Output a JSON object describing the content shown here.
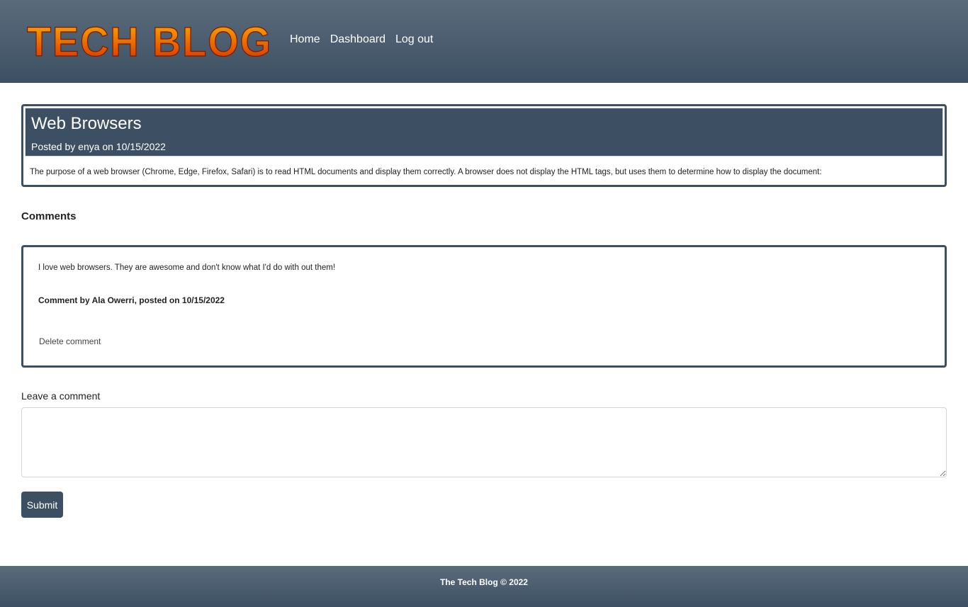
{
  "header": {
    "logo_text": "TECH BLOG",
    "nav": [
      "Home",
      "Dashboard",
      "Log out"
    ]
  },
  "post": {
    "title": "Web Browsers",
    "meta": "Posted by enya on 10/15/2022",
    "body": "The purpose of a web browser (Chrome, Edge, Firefox, Safari) is to read HTML documents and display them correctly. A browser does not display the HTML tags, but uses them to determine how to display the document:"
  },
  "comments": {
    "heading": "Comments",
    "items": [
      {
        "text": "I love web browsers. They are awesome and don't know what I'd do with out them!",
        "meta": "Comment by Ala Owerri, posted on 10/15/2022",
        "delete_label": "Delete comment"
      }
    ]
  },
  "form": {
    "label": "Leave a comment",
    "value": "",
    "submit_label": "Submit"
  },
  "footer": {
    "text": "The Tech Blog © 2022"
  },
  "colors": {
    "primary": "#3d5063",
    "logo_top": "#ffb000",
    "logo_bottom": "#d42a00"
  }
}
